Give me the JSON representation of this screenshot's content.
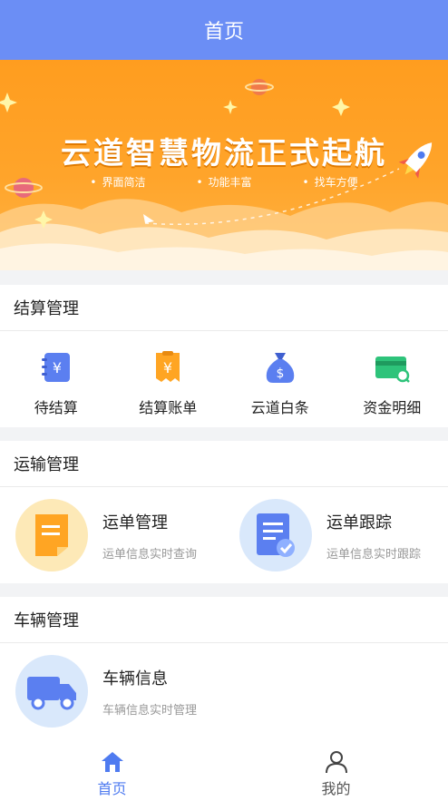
{
  "header": {
    "title": "首页"
  },
  "banner": {
    "headline": "云道智慧物流正式起航",
    "tags": [
      "界面简洁",
      "功能丰富",
      "找车方便"
    ]
  },
  "settlement": {
    "title": "结算管理",
    "items": [
      {
        "label": "待结算",
        "icon": "yen-notebook-icon"
      },
      {
        "label": "结算账单",
        "icon": "yen-bill-icon"
      },
      {
        "label": "云道白条",
        "icon": "money-bag-icon"
      },
      {
        "label": "资金明细",
        "icon": "card-search-icon"
      }
    ]
  },
  "transport": {
    "title": "运输管理",
    "items": [
      {
        "title": "运单管理",
        "subtitle": "运单信息实时查询",
        "icon": "document-icon"
      },
      {
        "title": "运单跟踪",
        "subtitle": "运单信息实时跟踪",
        "icon": "document-check-icon"
      }
    ]
  },
  "vehicle": {
    "title": "车辆管理",
    "items": [
      {
        "title": "车辆信息",
        "subtitle": "车辆信息实时管理",
        "icon": "truck-icon"
      }
    ]
  },
  "tabbar": {
    "tabs": [
      {
        "label": "首页",
        "icon": "home-icon",
        "active": true
      },
      {
        "label": "我的",
        "icon": "user-icon",
        "active": false
      }
    ]
  },
  "colors": {
    "header": "#6b8ef5",
    "accent": "#4f7bf0",
    "banner": "#ffa42a"
  }
}
